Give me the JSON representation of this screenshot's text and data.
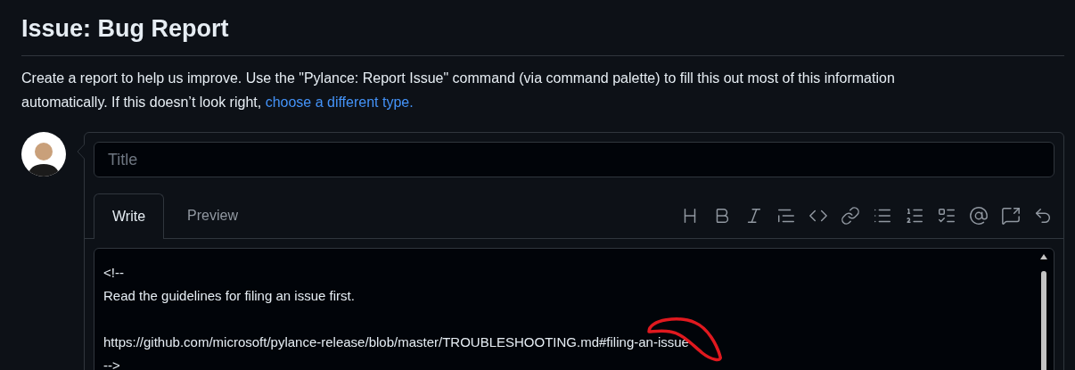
{
  "heading": "Issue: Bug Report",
  "description": {
    "text": "Create a report to help us improve. Use the \"Pylance: Report Issue\" command (via command palette) to fill this out most of this information automatically. If this doesn’t look right,",
    "link": "choose a different type."
  },
  "title_field": {
    "placeholder": "Title"
  },
  "tabs": [
    {
      "label": "Write",
      "selected": true
    },
    {
      "label": "Preview",
      "selected": false
    }
  ],
  "body_field": {
    "value": "<!--\nRead the guidelines for filing an issue first.\n\nhttps://github.com/microsoft/pylance-release/blob/master/TROUBLESHOOTING.md#filing-an-issue\n-->"
  }
}
